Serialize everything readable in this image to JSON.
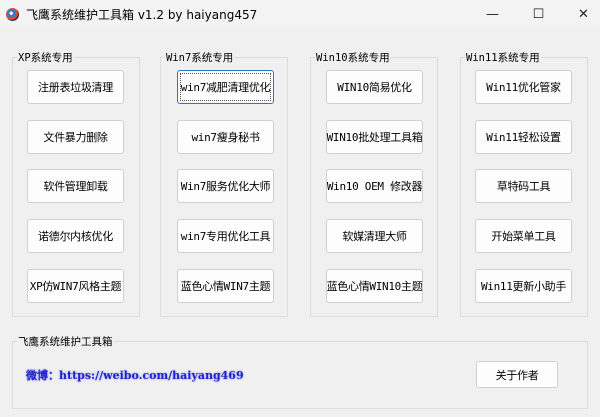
{
  "window": {
    "title": "飞鹰系统维护工具箱 v1.2 by haiyang457",
    "minimize": "—",
    "maximize": "☐",
    "close": "✕"
  },
  "groups": [
    {
      "label": "XP系统专用",
      "buttons": [
        "注册表垃圾清理",
        "文件暴力删除",
        "软件管理卸载",
        "诺德尔内核优化",
        "XP仿WIN7风格主题"
      ]
    },
    {
      "label": "Win7系统专用",
      "buttons": [
        "win7减肥清理优化",
        "win7瘦身秘书",
        "Win7服务优化大师",
        "win7专用优化工具",
        "蓝色心情WIN7主题"
      ]
    },
    {
      "label": "Win10系统专用",
      "buttons": [
        "WIN10简易优化",
        "WIN10批处理工具箱",
        "Win10 OEM 修改器",
        "软媒清理大师",
        "蓝色心情WIN10主题"
      ]
    },
    {
      "label": "Win11系统专用",
      "buttons": [
        "Win11优化管家",
        "Win11轻松设置",
        "草特码工具",
        "开始菜单工具",
        "Win11更新小助手"
      ]
    }
  ],
  "footer": {
    "label": "飞鹰系统维护工具箱",
    "link": "微博：https://weibo.com/haiyang469",
    "about": "关于作者"
  }
}
